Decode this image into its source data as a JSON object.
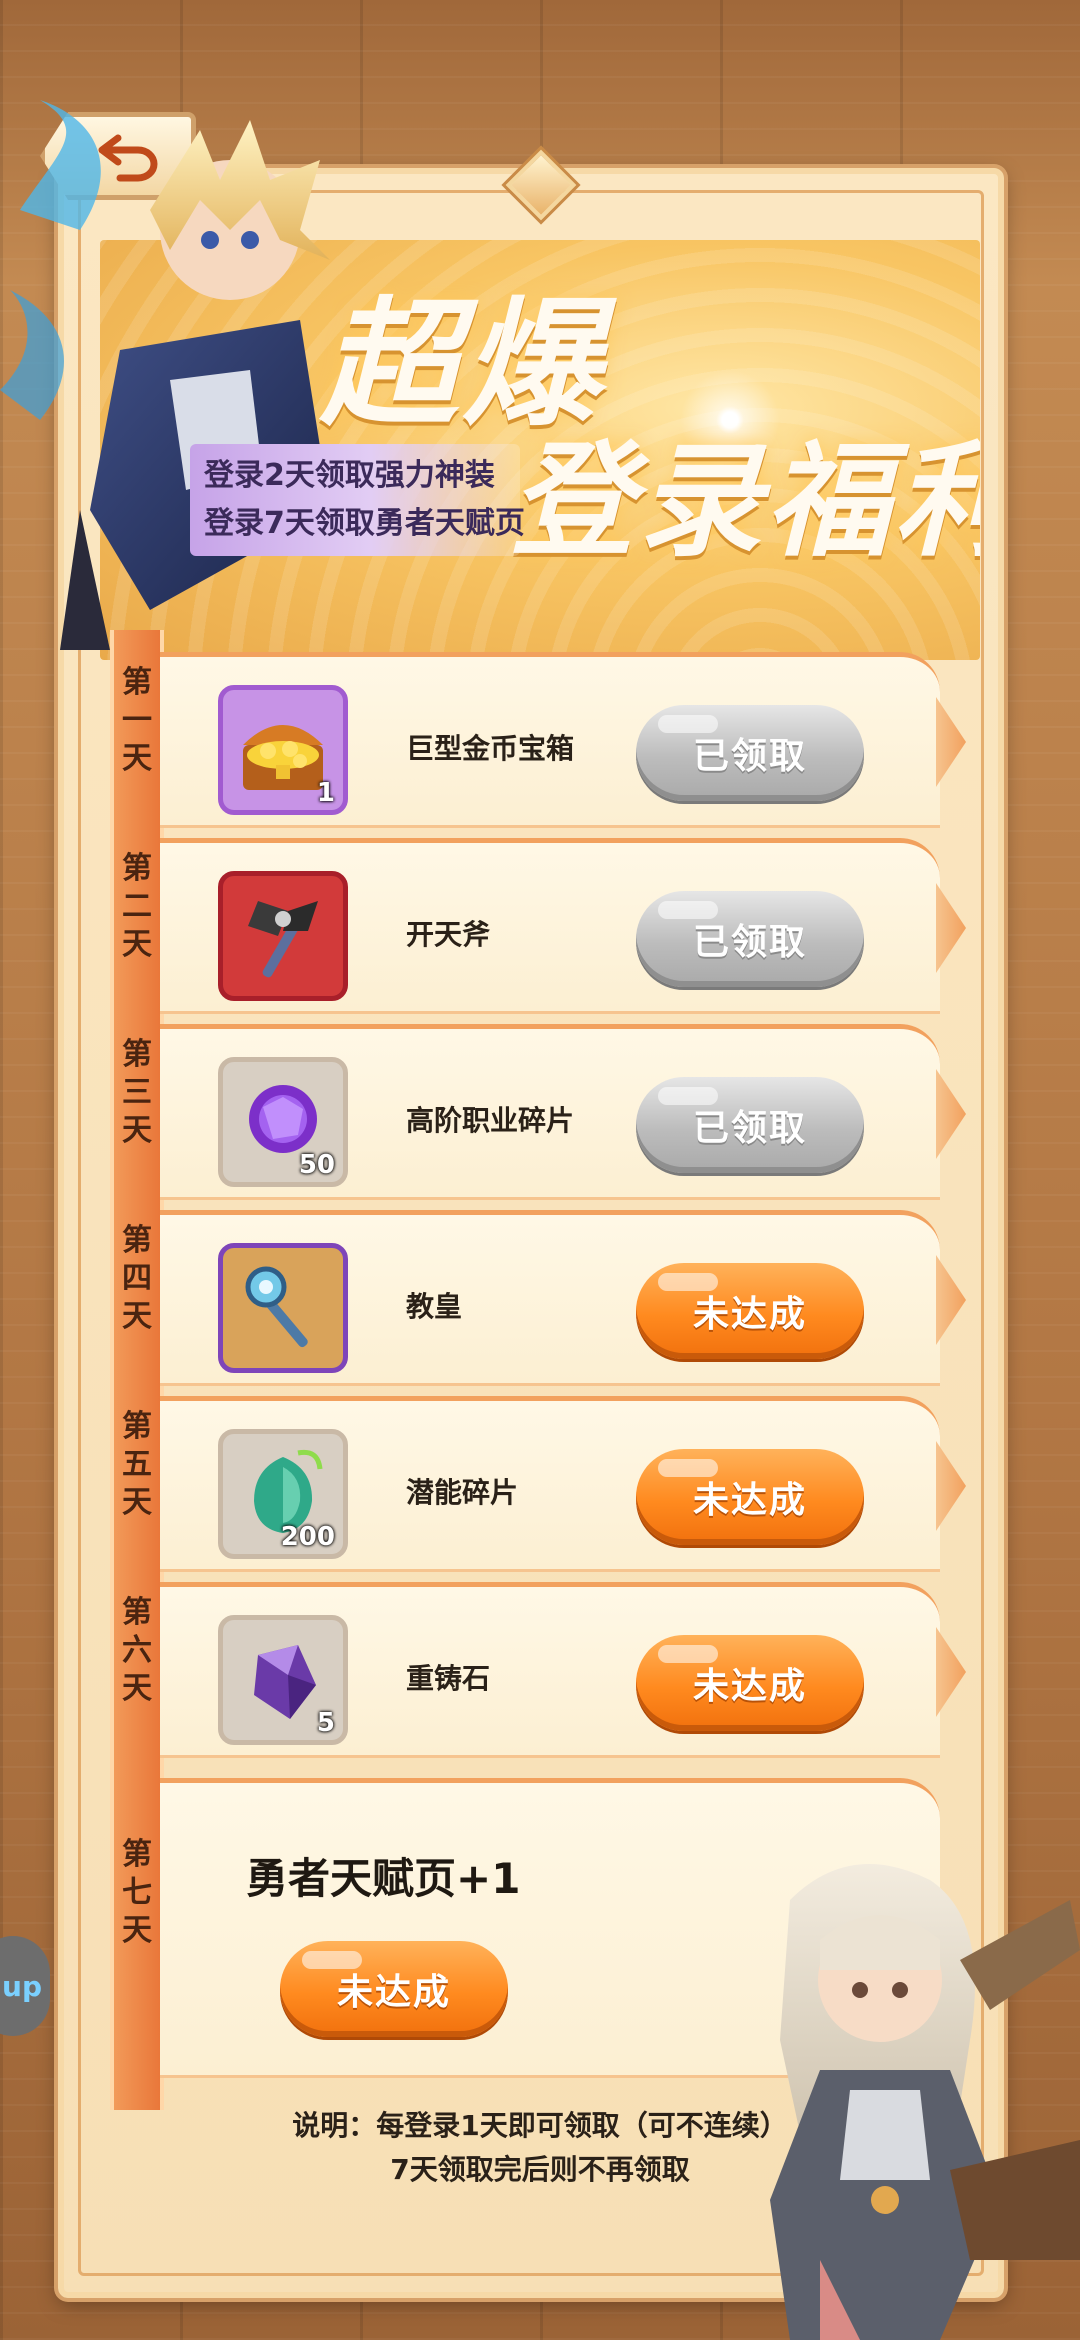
{
  "banner": {
    "title_line1": "超爆",
    "title_line2": "登录福利",
    "tip_line1": "登录2天领取强力神装",
    "tip_line2": "登录7天领取勇者天赋页"
  },
  "days": [
    "第一天",
    "第二天",
    "第三天",
    "第四天",
    "第五天",
    "第六天",
    "第七天"
  ],
  "rewards": [
    {
      "name": "巨型金币宝箱",
      "qty": "1",
      "status": "已领取",
      "icon": "treasure-chest-icon"
    },
    {
      "name": "开天斧",
      "qty": "",
      "status": "已领取",
      "icon": "axe-icon"
    },
    {
      "name": "高阶职业碎片",
      "qty": "50",
      "status": "已领取",
      "icon": "purple-orb-icon"
    },
    {
      "name": "教皇",
      "qty": "",
      "status": "未达成",
      "icon": "scepter-icon"
    },
    {
      "name": "潜能碎片",
      "qty": "200",
      "status": "未达成",
      "icon": "green-gem-icon"
    },
    {
      "name": "重铸石",
      "qty": "5",
      "status": "未达成",
      "icon": "crystal-icon"
    }
  ],
  "day7": {
    "reward": "勇者天赋页+1",
    "status": "未达成"
  },
  "note": {
    "line1": "说明：每登录1天即可领取（可不连续）",
    "line2": "7天领取完后则不再领取"
  },
  "side_tab": "up",
  "colors": {
    "claimed": "#bcbcbc",
    "pending": "#ff8a1f",
    "ribbon": "#e9773a"
  }
}
